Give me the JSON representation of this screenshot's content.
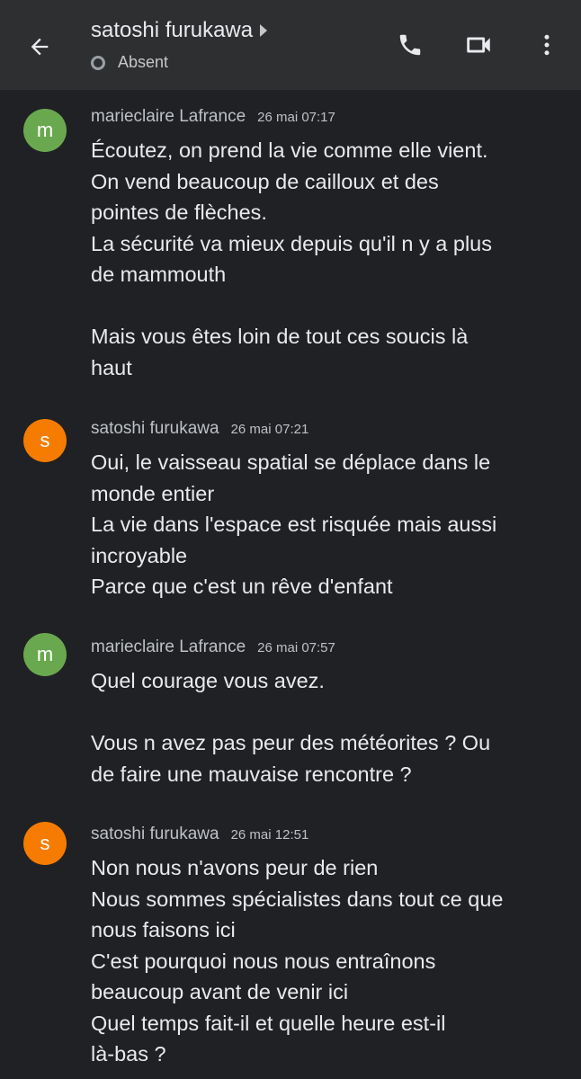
{
  "header": {
    "contact_name": "satoshi furukawa",
    "status": "Absent",
    "icons": {
      "back": "arrow-back-icon",
      "expand": "caret-right-icon",
      "status": "status-circle-icon",
      "call": "phone-icon",
      "video": "video-call-icon",
      "menu": "more-vert-icon"
    }
  },
  "colors": {
    "background": "#202124",
    "header_background": "#2d2f31",
    "avatar_marieclaire": "#6aa84f",
    "avatar_satoshi": "#f57c00"
  },
  "messages": [
    {
      "avatar_letter": "m",
      "sender": "marieclaire Lafrance",
      "time": "26 mai 07:17",
      "lines": [
        "Écoutez,  on prend la vie comme elle vient.",
        "On vend beaucoup de cailloux et des",
        "pointes de flèches.",
        "La sécurité va mieux depuis qu'il n y a plus",
        "de mammouth",
        "",
        "Mais vous êtes loin de tout ces soucis là",
        "haut"
      ]
    },
    {
      "avatar_letter": "s",
      "sender": "satoshi furukawa",
      "time": "26 mai 07:21",
      "lines": [
        "Oui, le vaisseau spatial se déplace dans le",
        "monde entier",
        "La vie dans l'espace est risquée mais aussi",
        "incroyable",
        "Parce que c'est un rêve d'enfant"
      ]
    },
    {
      "avatar_letter": "m",
      "sender": "marieclaire Lafrance",
      "time": "26 mai 07:57",
      "lines": [
        "Quel courage vous avez.",
        "",
        "Vous n  avez pas peur des météorites ? Ou",
        "de faire une mauvaise rencontre ?"
      ]
    },
    {
      "avatar_letter": "s",
      "sender": "satoshi furukawa",
      "time": "26 mai 12:51",
      "lines": [
        "Non nous n'avons peur de rien",
        "Nous sommes spécialistes dans tout ce que",
        "nous faisons ici",
        "C'est pourquoi nous nous entraînons",
        "beaucoup avant de venir ici",
        "Quel temps fait-il et quelle heure est-il",
        "là-bas ?"
      ]
    }
  ]
}
